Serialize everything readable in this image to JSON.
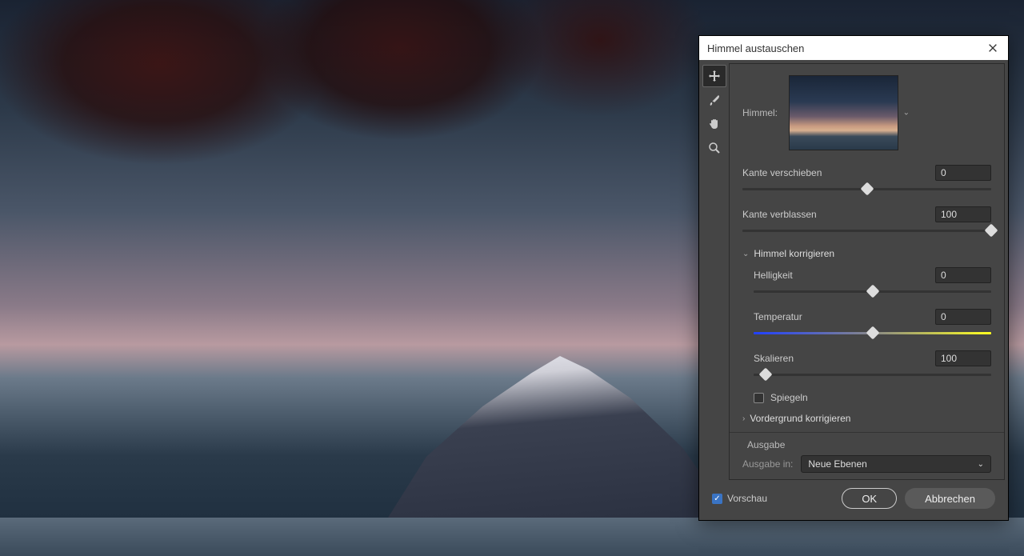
{
  "dialog": {
    "title": "Himmel austauschen",
    "sky_label": "Himmel:",
    "edge_shift": {
      "label": "Kante verschieben",
      "value": "0",
      "handle_pct": 50
    },
    "edge_fade": {
      "label": "Kante verblassen",
      "value": "100",
      "handle_pct": 100
    },
    "section_sky": "Himmel korrigieren",
    "brightness": {
      "label": "Helligkeit",
      "value": "0",
      "handle_pct": 50
    },
    "temperature": {
      "label": "Temperatur",
      "value": "0",
      "handle_pct": 50
    },
    "scale": {
      "label": "Skalieren",
      "value": "100",
      "handle_pct": 5
    },
    "flip_label": "Spiegeln",
    "section_foreground": "Vordergrund korrigieren",
    "output_title": "Ausgabe",
    "output_label": "Ausgabe in:",
    "output_value": "Neue Ebenen",
    "preview_label": "Vorschau",
    "ok_label": "OK",
    "cancel_label": "Abbrechen"
  }
}
